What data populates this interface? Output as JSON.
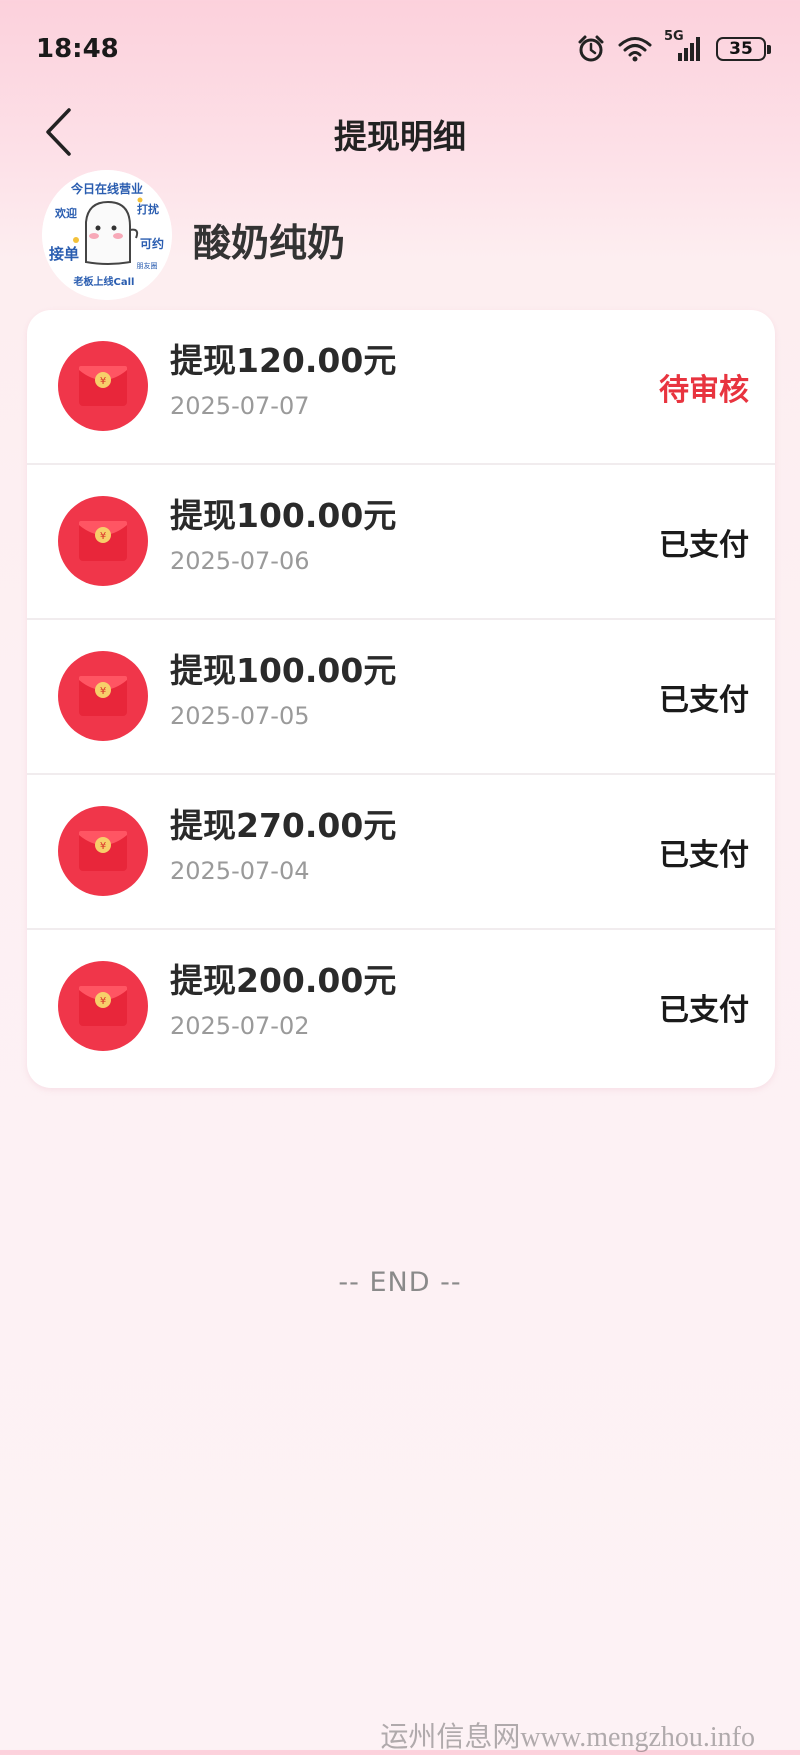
{
  "status_bar": {
    "time": "18:48",
    "network": "5G",
    "battery": "35"
  },
  "header": {
    "title": "提现明细",
    "back_icon": "chevron-left-icon"
  },
  "profile": {
    "name": "酸奶纯奶",
    "avatar_text": {
      "top": "今日在线营业",
      "left1": "欢迎",
      "right1": "打扰",
      "left2": "接单",
      "right2": "可约",
      "bottom": "老板上线Call",
      "small": "朋友圈"
    }
  },
  "withdrawals": [
    {
      "title": "提现120.00元",
      "date": "2025-07-07",
      "status": "待审核",
      "pending": true
    },
    {
      "title": "提现100.00元",
      "date": "2025-07-06",
      "status": "已支付",
      "pending": false
    },
    {
      "title": "提现100.00元",
      "date": "2025-07-05",
      "status": "已支付",
      "pending": false
    },
    {
      "title": "提现270.00元",
      "date": "2025-07-04",
      "status": "已支付",
      "pending": false
    },
    {
      "title": "提现200.00元",
      "date": "2025-07-02",
      "status": "已支付",
      "pending": false
    }
  ],
  "footer": {
    "end_text": "-- END --"
  },
  "watermark": "运州信息网www.mengzhou.info",
  "colors": {
    "pending": "#e8343f",
    "paid": "#1a1a1a",
    "accent": "#f0364a"
  }
}
